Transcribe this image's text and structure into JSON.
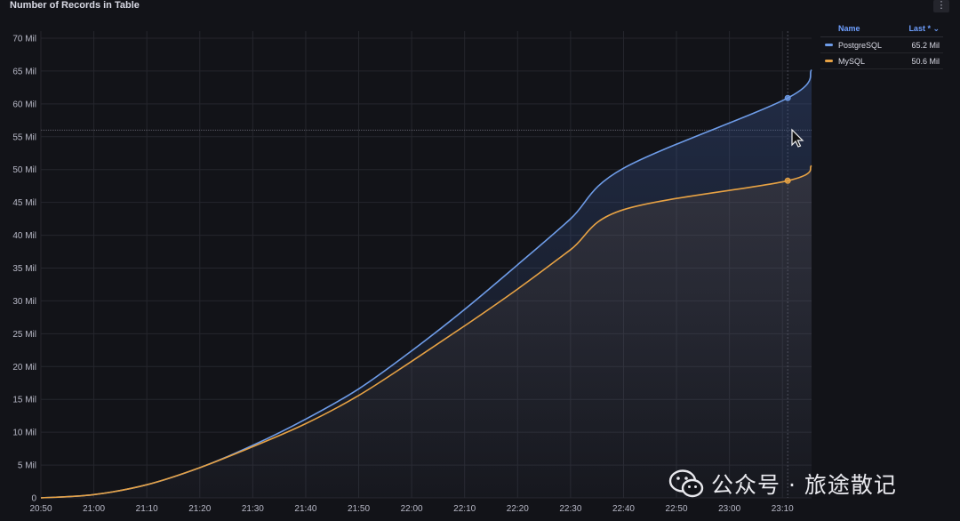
{
  "panel": {
    "title": "Number of Records in Table",
    "menu_icon": "kebab-menu-icon"
  },
  "legend": {
    "col_name": "Name",
    "col_value": "Last * ⌄",
    "items": [
      {
        "name": "PostgreSQL",
        "value": "65.2 Mil",
        "color": "#6e9ce8"
      },
      {
        "name": "MySQL",
        "value": "50.6 Mil",
        "color": "#e7a244"
      }
    ]
  },
  "watermark": {
    "text": "公众号 · 旅途散记",
    "icon": "wechat-icon"
  },
  "chart_data": {
    "type": "area",
    "title": "Number of Records in Table",
    "x_ticks": [
      "20:50",
      "21:00",
      "21:10",
      "21:20",
      "21:30",
      "21:40",
      "21:50",
      "22:00",
      "22:10",
      "22:20",
      "22:30",
      "22:40",
      "22:50",
      "23:00",
      "23:10"
    ],
    "y_ticks": [
      "0",
      "5 Mil",
      "10 Mil",
      "15 Mil",
      "20 Mil",
      "25 Mil",
      "30 Mil",
      "35 Mil",
      "40 Mil",
      "45 Mil",
      "50 Mil",
      "55 Mil",
      "60 Mil",
      "65 Mil",
      "70 Mil"
    ],
    "x_range_minutes": [
      0,
      145.5
    ],
    "ylim": [
      0,
      70
    ],
    "y_unit": "Mil",
    "x_minutes": [
      0,
      10,
      20,
      30,
      40,
      50,
      60,
      70,
      80,
      90,
      100,
      110,
      120,
      130,
      140,
      141,
      145.5
    ],
    "series": [
      {
        "name": "PostgreSQL",
        "color": "#6e9ce8",
        "values": [
          0,
          0.5,
          2.0,
          4.6,
          8.0,
          12.0,
          16.6,
          22.4,
          28.7,
          35.5,
          42.5,
          50.2,
          60.9,
          65.2
        ]
      },
      {
        "name": "MySQL",
        "color": "#e7a244",
        "values": [
          0,
          0.5,
          2.0,
          4.6,
          7.8,
          11.3,
          15.6,
          20.8,
          26.2,
          31.8,
          37.8,
          43.9,
          48.3,
          50.6
        ]
      }
    ],
    "series_x_minutes": [
      0,
      10,
      20,
      30,
      40,
      50,
      60,
      70,
      80,
      90,
      100,
      110,
      141,
      145.5
    ],
    "hover_x_minutes": 141,
    "hover_values": [
      60.9,
      48.3
    ],
    "crosshair_y": 56,
    "grid": true
  }
}
